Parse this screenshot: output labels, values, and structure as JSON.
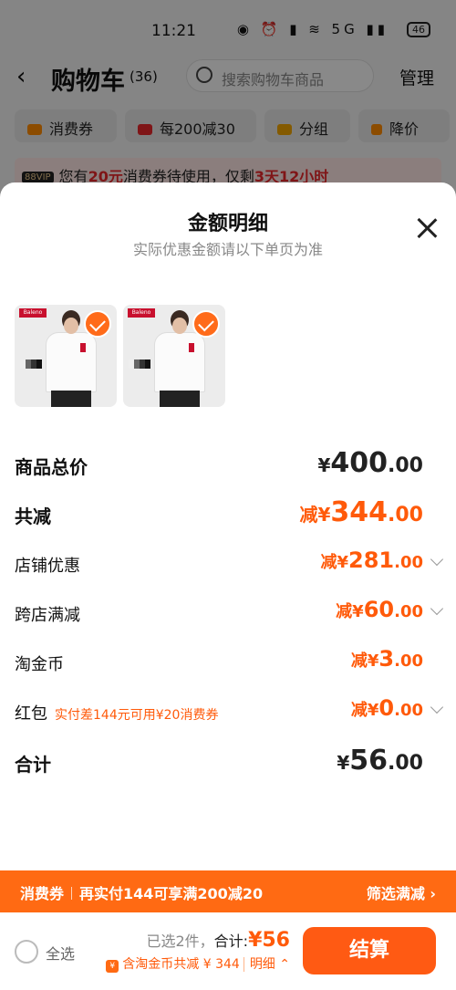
{
  "status_bar": {
    "time": "11:21",
    "icons": "◉ ⏰ ▮ ≋ 5G ▮▮",
    "battery": "46"
  },
  "header": {
    "title": "购物车",
    "count": "(36)",
    "search_placeholder": "搜索购物车商品",
    "manage": "管理"
  },
  "chips": [
    {
      "label": "消费券"
    },
    {
      "label": "每200减30"
    },
    {
      "label": "分组"
    },
    {
      "label": "降价"
    }
  ],
  "vip_bar": {
    "badge": "88VIP",
    "text1": "您有",
    "amount": "20元",
    "text2": "消费券待使用，仅剩",
    "time": "3天12小时"
  },
  "sheet": {
    "title": "金额明细",
    "subtitle": "实际优惠金额请以下单页为准",
    "products": [
      {
        "brand": "Baleno"
      },
      {
        "brand": "Baleno"
      }
    ],
    "rows": {
      "total": {
        "label": "商品总价",
        "prefix": "¥",
        "int": "400",
        "dec": ".00"
      },
      "discount": {
        "label": "共减",
        "prefix": "减¥",
        "int": "344",
        "dec": ".00"
      },
      "shop": {
        "label": "店铺优惠",
        "prefix": "减¥",
        "int": "281",
        "dec": ".00"
      },
      "cross": {
        "label": "跨店满减",
        "prefix": "减¥",
        "int": "60",
        "dec": ".00"
      },
      "coin": {
        "label": "淘金币",
        "prefix": "减¥",
        "int": "3",
        "dec": ".00"
      },
      "redpack": {
        "label": "红包",
        "note": "实付差144元可用¥20消费券",
        "prefix": "减¥",
        "int": "0",
        "dec": ".00"
      },
      "sum": {
        "label": "合计",
        "prefix": "¥",
        "int": "56",
        "dec": ".00"
      }
    }
  },
  "promo": {
    "tag": "消费券",
    "text": "再实付144可享满200减20",
    "link": "筛选满减 ›"
  },
  "bottom": {
    "select_all": "全选",
    "selected": "已选2件，",
    "total_label": "合计:",
    "total_price": "¥56",
    "coin_icon": "¥",
    "coin_text": "含淘金币共减 ¥ 344",
    "detail": "明细 ⌃",
    "checkout": "结算"
  },
  "colors": {
    "accent": "#ff5a0a",
    "promo_bg": "#ff6a13"
  }
}
